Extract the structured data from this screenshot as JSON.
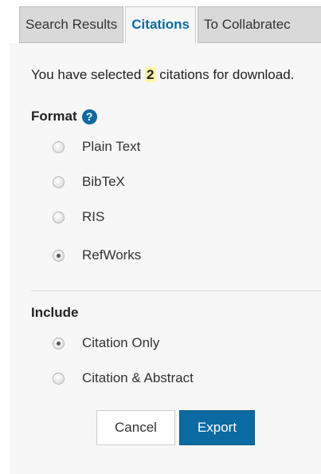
{
  "tabs": [
    {
      "label": "Search Results",
      "active": false
    },
    {
      "label": "Citations",
      "active": true
    },
    {
      "label": "To Collabratec",
      "active": false
    }
  ],
  "summary": {
    "prefix": "You have selected ",
    "count": "2",
    "suffix": " citations for download."
  },
  "format": {
    "title": "Format",
    "help_icon": "question-circle-icon",
    "options": [
      {
        "label": "Plain Text",
        "checked": false
      },
      {
        "label": "BibTeX",
        "checked": false
      },
      {
        "label": "RIS",
        "checked": false
      },
      {
        "label": "RefWorks",
        "checked": true
      }
    ]
  },
  "include": {
    "title": "Include",
    "options": [
      {
        "label": "Citation Only",
        "checked": true
      },
      {
        "label": "Citation & Abstract",
        "checked": false
      }
    ]
  },
  "buttons": {
    "cancel_label": "Cancel",
    "export_label": "Export"
  },
  "colors": {
    "accent": "#0b6aa2",
    "highlight": "#fdf5a8"
  }
}
